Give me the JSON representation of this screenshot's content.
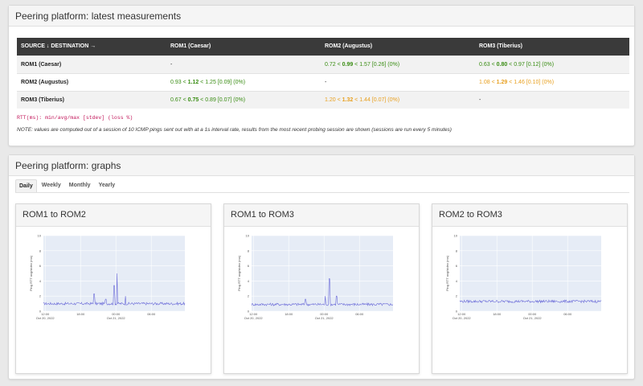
{
  "latest": {
    "title": "Peering platform: latest measurements",
    "headers": [
      "SOURCE ↓ DESTINATION →",
      "ROM1 (Caesar)",
      "ROM2 (Augustus)",
      "ROM3 (Tiberius)"
    ],
    "rows": [
      {
        "src": "ROM1 (Caesar)",
        "cells": [
          {
            "dash": "-"
          },
          {
            "pre": "0.72 < ",
            "avg": "0.99",
            "post": " < 1.57 [0.26] (0%)",
            "color": "#3a8d14"
          },
          {
            "pre": "0.63 < ",
            "avg": "0.80",
            "post": " < 0.97 [0.12] (0%)",
            "color": "#3a8d14"
          }
        ]
      },
      {
        "src": "ROM2 (Augustus)",
        "cells": [
          {
            "pre": "0.93 < ",
            "avg": "1.12",
            "post": " < 1.25 [0.09] (0%)",
            "color": "#3a8d14"
          },
          {
            "dash": "-"
          },
          {
            "pre": "1.08 < ",
            "avg": "1.29",
            "post": " < 1.46 [0.10] (0%)",
            "color": "#e8a020"
          }
        ]
      },
      {
        "src": "ROM3 (Tiberius)",
        "cells": [
          {
            "pre": "0.67 < ",
            "avg": "0.75",
            "post": " < 0.89 [0.07] (0%)",
            "color": "#3a8d14"
          },
          {
            "pre": "1.20 < ",
            "avg": "1.32",
            "post": " < 1.44 [0.07] (0%)",
            "color": "#e8a020"
          },
          {
            "dash": "-"
          }
        ]
      }
    ],
    "legend": "RTT(ms): min/avg/max [stdev] (loss %)",
    "note": "NOTE: values are computed out of a session of 10 ICMP pings sent out with at a 1s interval rate, results from the most recent probing session are shown (sessions are run every 5 minutes)"
  },
  "graphs": {
    "title": "Peering platform: graphs",
    "tabs": [
      "Daily",
      "Weekly",
      "Monthly",
      "Yearly"
    ],
    "active_tab": "Daily",
    "cards": [
      {
        "title": "ROM1 to ROM2"
      },
      {
        "title": "ROM1 to ROM3"
      },
      {
        "title": "ROM2 to ROM3"
      }
    ]
  },
  "chart_data": [
    {
      "type": "line",
      "title": "ROM1 to ROM2",
      "ylabel": "Ping RTT avg/stdev (ms)",
      "ylim": [
        0,
        10
      ],
      "yticks": [
        "0",
        "2",
        "4",
        "6",
        "8",
        "10"
      ],
      "xticks": [
        {
          "label": "12:00",
          "sub": "Oct 20, 2022"
        },
        {
          "label": "18:00",
          "sub": ""
        },
        {
          "label": "00:00",
          "sub": "Oct 21, 2022"
        },
        {
          "label": "06:00",
          "sub": ""
        }
      ],
      "baseline": 1.0,
      "spikes": [
        [
          0.36,
          2.3
        ],
        [
          0.44,
          1.6
        ],
        [
          0.5,
          3.4
        ],
        [
          0.52,
          5.0
        ],
        [
          0.58,
          2.0
        ]
      ]
    },
    {
      "type": "line",
      "title": "ROM1 to ROM3",
      "ylabel": "Ping RTT avg/stdev (ms)",
      "ylim": [
        0,
        10
      ],
      "yticks": [
        "0",
        "2",
        "4",
        "6",
        "8",
        "10"
      ],
      "xticks": [
        {
          "label": "12:00",
          "sub": "Oct 20, 2022"
        },
        {
          "label": "18:00",
          "sub": ""
        },
        {
          "label": "00:00",
          "sub": "Oct 21, 2022"
        },
        {
          "label": "06:00",
          "sub": ""
        }
      ],
      "baseline": 0.9,
      "spikes": [
        [
          0.38,
          1.6
        ],
        [
          0.52,
          2.0
        ],
        [
          0.55,
          4.3
        ],
        [
          0.6,
          2.0
        ]
      ]
    },
    {
      "type": "line",
      "title": "ROM2 to ROM3",
      "ylabel": "Ping RTT avg/stdev (ms)",
      "ylim": [
        0,
        10
      ],
      "yticks": [
        "0",
        "2",
        "4",
        "6",
        "8",
        "10"
      ],
      "xticks": [
        {
          "label": "12:00",
          "sub": "Oct 20, 2022"
        },
        {
          "label": "18:00",
          "sub": ""
        },
        {
          "label": "00:00",
          "sub": "Oct 21, 2022"
        },
        {
          "label": "06:00",
          "sub": ""
        }
      ],
      "baseline": 1.3,
      "spikes": []
    }
  ]
}
